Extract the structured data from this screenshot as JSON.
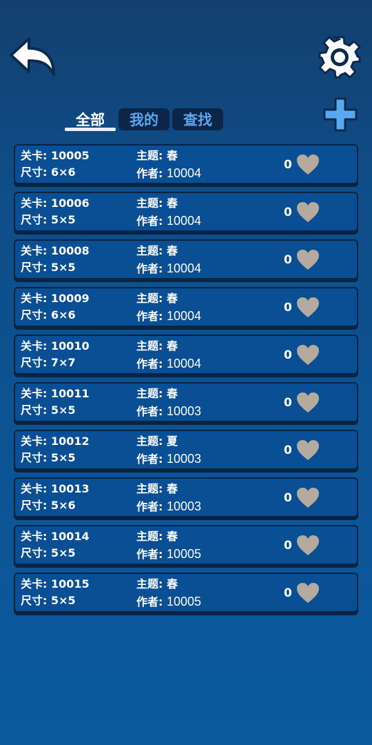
{
  "header": {
    "back_icon": "back-arrow-icon",
    "settings_icon": "gear-icon",
    "add_icon": "plus-icon"
  },
  "tabs": [
    {
      "label": "全部",
      "active": true
    },
    {
      "label": "我的",
      "active": false
    },
    {
      "label": "查找",
      "active": false
    }
  ],
  "labels": {
    "level": "关卡:",
    "size": "尺寸:",
    "theme": "主题:",
    "author": "作者:"
  },
  "levels": [
    {
      "id": "10005",
      "size": "6×6",
      "theme": "春",
      "author": "10004",
      "likes": "0"
    },
    {
      "id": "10006",
      "size": "5×5",
      "theme": "春",
      "author": "10004",
      "likes": "0"
    },
    {
      "id": "10008",
      "size": "5×5",
      "theme": "春",
      "author": "10004",
      "likes": "0"
    },
    {
      "id": "10009",
      "size": "6×6",
      "theme": "春",
      "author": "10004",
      "likes": "0"
    },
    {
      "id": "10010",
      "size": "7×7",
      "theme": "春",
      "author": "10004",
      "likes": "0"
    },
    {
      "id": "10011",
      "size": "5×5",
      "theme": "春",
      "author": "10003",
      "likes": "0"
    },
    {
      "id": "10012",
      "size": "5×5",
      "theme": "夏",
      "author": "10003",
      "likes": "0"
    },
    {
      "id": "10013",
      "size": "5×6",
      "theme": "春",
      "author": "10003",
      "likes": "0"
    },
    {
      "id": "10014",
      "size": "5×5",
      "theme": "春",
      "author": "10005",
      "likes": "0"
    },
    {
      "id": "10015",
      "size": "5×5",
      "theme": "春",
      "author": "10005",
      "likes": "0"
    }
  ],
  "colors": {
    "heart": "#b5aa9e",
    "tab_text": "#5aa7ef",
    "row_bg": "#0a4f94",
    "plus": "#59a9f0"
  }
}
